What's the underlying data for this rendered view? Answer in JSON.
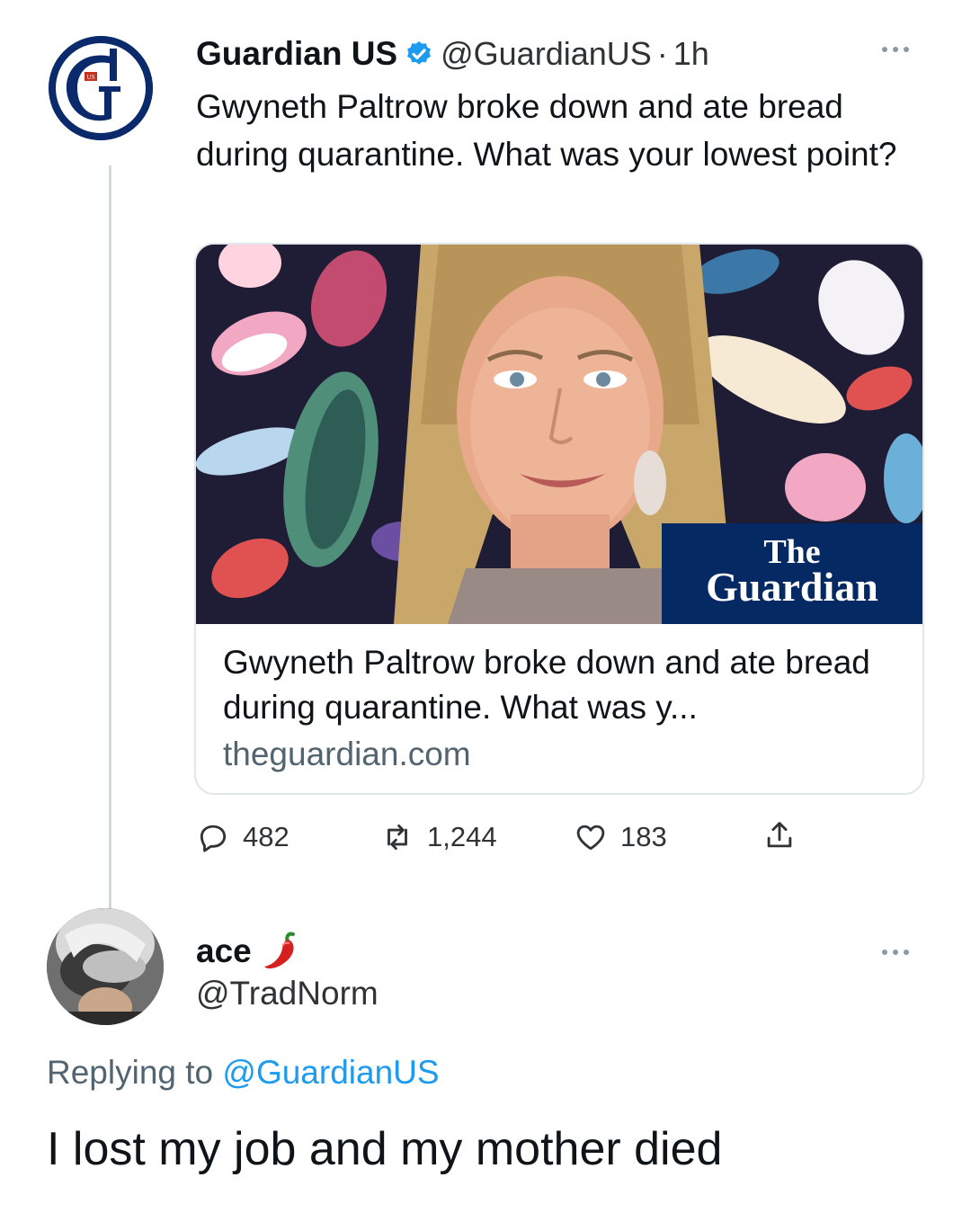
{
  "tweet": {
    "display_name": "Guardian US",
    "handle": "@GuardianUS",
    "separator": "·",
    "time": "1h",
    "text": "Gwyneth Paltrow broke down and ate bread during quarantine. What was your lowest point?",
    "avatar_icon": "guardian-g-logo-icon",
    "card": {
      "title": "Gwyneth Paltrow broke down and ate bread during quarantine. What was y...",
      "domain": "theguardian.com",
      "logo_line1": "The",
      "logo_line2": "Guardian"
    },
    "stats": {
      "replies": "482",
      "retweets": "1,244",
      "likes": "183"
    }
  },
  "reply": {
    "display_name": "ace",
    "name_emoji": "chili-pepper-icon",
    "handle": "@TradNorm",
    "replying_prefix": "Replying to",
    "replying_to": "@GuardianUS",
    "text": "I lost my job and my mother died"
  },
  "colors": {
    "link_blue": "#1d9bf0",
    "guardian_navy": "#052962",
    "secondary_text": "#536471"
  }
}
